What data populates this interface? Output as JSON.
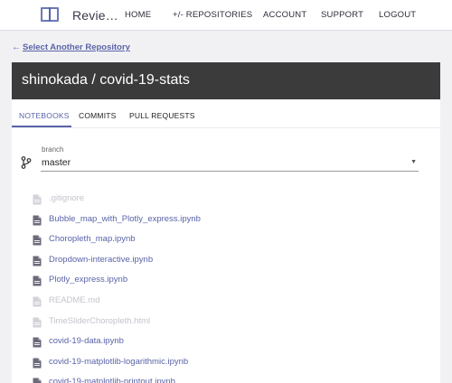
{
  "app": {
    "brand": "Revie…"
  },
  "nav": {
    "items": [
      {
        "label": "HOME"
      },
      {
        "label": "+/- REPOSITORIES"
      },
      {
        "label": "ACCOUNT"
      },
      {
        "label": "SUPPORT"
      },
      {
        "label": "LOGOUT"
      }
    ]
  },
  "back_link": {
    "arrow": "←",
    "label": "Select Another Repository"
  },
  "repo": {
    "title": "shinokada / covid-19-stats"
  },
  "tabs": [
    {
      "label": "NOTEBOOKS",
      "active": true
    },
    {
      "label": "COMMITS",
      "active": false
    },
    {
      "label": "PULL REQUESTS",
      "active": false
    }
  ],
  "branch": {
    "label": "branch",
    "value": "master"
  },
  "files": [
    {
      "name": ".gitignore",
      "enabled": false
    },
    {
      "name": "Bubble_map_with_Plotly_express.ipynb",
      "enabled": true
    },
    {
      "name": "Choropleth_map.ipynb",
      "enabled": true
    },
    {
      "name": "Dropdown-interactive.ipynb",
      "enabled": true
    },
    {
      "name": "Plotly_express.ipynb",
      "enabled": true
    },
    {
      "name": "README.md",
      "enabled": false
    },
    {
      "name": "TimeSliderChoropleth.html",
      "enabled": false
    },
    {
      "name": "covid-19-data.ipynb",
      "enabled": true
    },
    {
      "name": "covid-19-matplotlib-logarithmic.ipynb",
      "enabled": true
    },
    {
      "name": "covid-19-matplotlib-printout.ipynb",
      "enabled": true
    }
  ],
  "colors": {
    "accent": "#5a63a8",
    "header_bg": "#3b3b3b",
    "disabled_text": "#c4c4cc",
    "page_bg": "#f1f1f4"
  }
}
